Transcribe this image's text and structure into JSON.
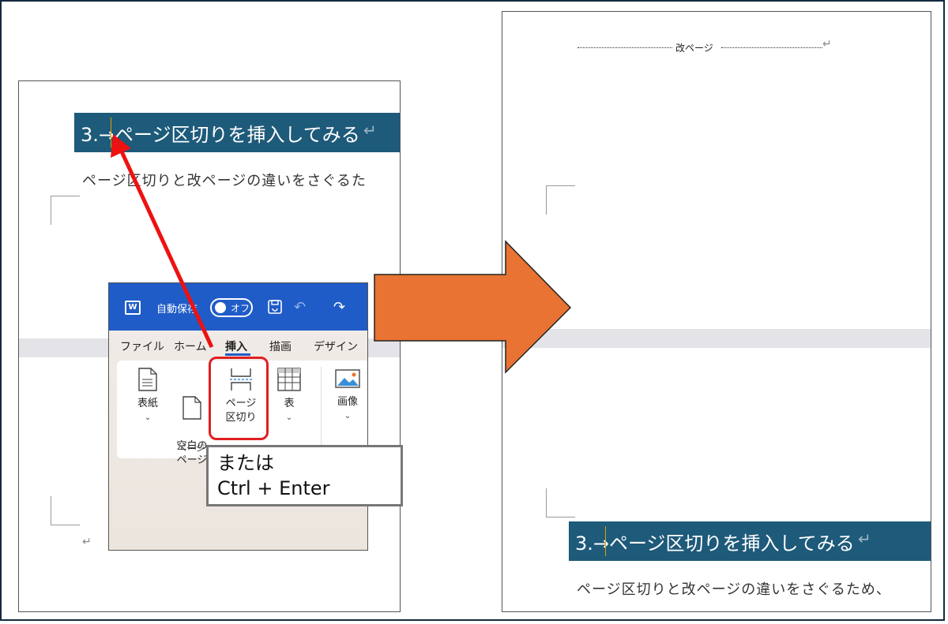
{
  "left_doc": {
    "heading": "3.→ページ区切りを挿入してみる",
    "pilcrow": "↵",
    "body_line": "ページ区切りと改ページの違いをさぐるた",
    "end_mark": "↵"
  },
  "ribbon": {
    "autosave_label": "自動保存",
    "toggle_label": "オフ",
    "app_icon": "W",
    "tabs": [
      "ファイル",
      "ホーム",
      "挿入",
      "描画",
      "デザイン"
    ],
    "active_tab": "挿入",
    "buttons": [
      {
        "label": "表紙",
        "icon": "cover-page-icon"
      },
      {
        "label": "空白の\nページ",
        "icon": "blank-page-icon"
      },
      {
        "label": "ページ\n区切り",
        "icon": "page-break-icon"
      },
      {
        "label": "表",
        "icon": "table-icon"
      },
      {
        "label": "画像",
        "icon": "picture-icon"
      }
    ],
    "group_label": "ページ"
  },
  "tooltip": {
    "line1": "または",
    "line2": "Ctrl + Enter"
  },
  "right_doc": {
    "page_break_label": "改ページ",
    "pilcrow": "↵",
    "heading": "3.→ページ区切りを挿入してみる",
    "body_line": "ページ区切りと改ページの違いをさぐるため、"
  },
  "colors": {
    "heading_bg": "#1e5a7a",
    "ribbon_title_bg": "#1f5cc8",
    "highlight": "#e02020",
    "arrow": "#e87332"
  }
}
